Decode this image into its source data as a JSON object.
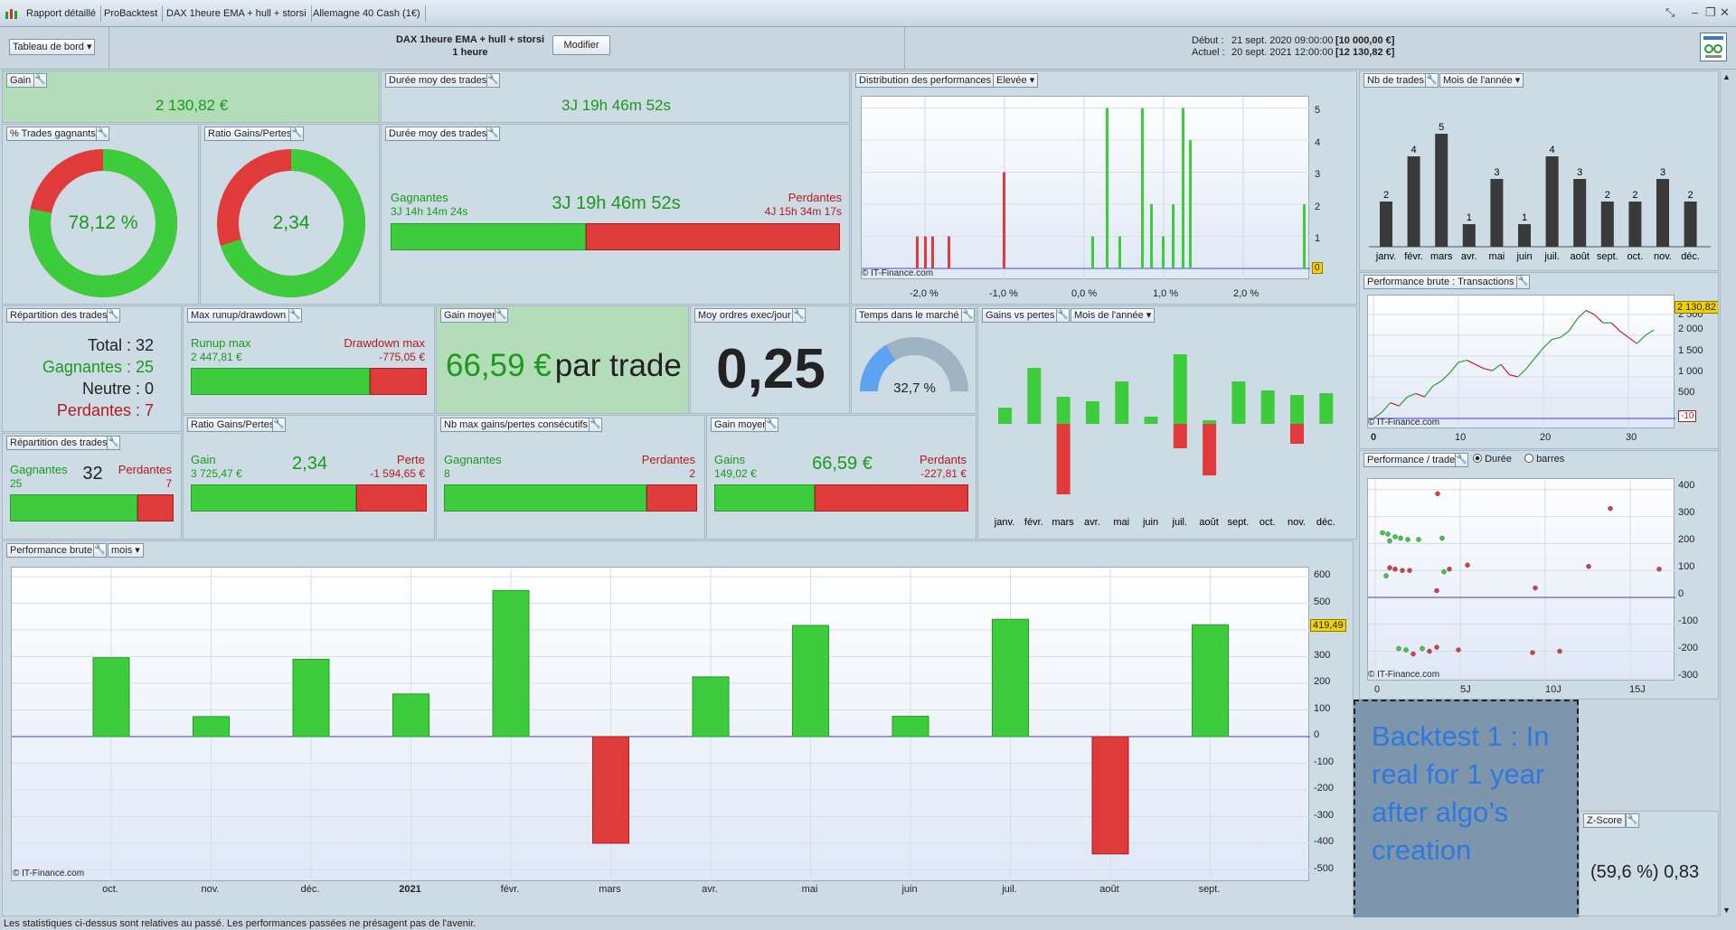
{
  "titlebar": {
    "tabs": [
      "Rapport détaillé",
      "ProBacktest",
      "DAX 1heure EMA + hull + storsi",
      "Allemagne 40 Cash (1€)"
    ]
  },
  "header": {
    "dashboard_select": "Tableau de bord",
    "strategy_name": "DAX 1heure EMA + hull + storsi",
    "timeframe": "1 heure",
    "modify_button": "Modifier",
    "start_label": "Début :",
    "start_date": "21 sept. 2020 09:00:00",
    "start_capital": "[10 000,00 €]",
    "current_label": "Actuel :",
    "current_date": "20 sept. 2021 12:00:00",
    "current_capital": "[12 130,82 €]"
  },
  "gain": {
    "title": "Gain",
    "value": "2 130,82 €"
  },
  "avg_duration": {
    "title": "Durée moy des trades",
    "value": "3J 19h 46m 52s"
  },
  "pct_winners": {
    "title": "% Trades gagnants",
    "value": "78,12 %",
    "fraction": 0.7812
  },
  "ratio_gp": {
    "title": "Ratio Gains/Pertes",
    "value": "2,34",
    "fraction": 0.7004
  },
  "avg_duration2": {
    "title": "Durée moy des trades",
    "win_label": "Gagnantes",
    "win_value": "3J 14h 14m 24s",
    "center": "3J 19h 46m 52s",
    "lose_label": "Perdantes",
    "lose_value": "4J 15h 34m 17s",
    "win_fraction": 0.434
  },
  "distribution": {
    "title": "Distribution des performances",
    "select": "Elevée",
    "credit": "© IT-Finance.com",
    "x_ticks": [
      "-2,0 %",
      "-1,0 %",
      "0,0 %",
      "1,0 %",
      "2,0 %"
    ],
    "y_ticks": [
      "5",
      "4",
      "3",
      "2",
      "1",
      "0"
    ],
    "marker": "0"
  },
  "nb_trades": {
    "title": "Nb de trades",
    "select": "Mois de l'année",
    "categories": [
      "janv.",
      "févr.",
      "mars",
      "avr.",
      "mai",
      "juin",
      "juil.",
      "août",
      "sept.",
      "oct.",
      "nov.",
      "déc."
    ],
    "values": [
      2,
      4,
      5,
      1,
      3,
      1,
      4,
      3,
      2,
      2,
      3,
      2
    ],
    "labels": [
      "2",
      "4",
      "5",
      "1",
      "3",
      "1",
      "4",
      "3",
      "2",
      "2",
      "3",
      "2"
    ]
  },
  "repartition": {
    "title": "Répartition des trades",
    "total": "Total : 32",
    "winners": "Gagnantes : 25",
    "neutral": "Neutre : 0",
    "losers": "Perdantes : 7"
  },
  "runup": {
    "title": "Max runup/drawdown",
    "runup_label": "Runup max",
    "runup_value": "2 447,81 €",
    "drawdown_label": "Drawdown max",
    "drawdown_value": "-775,05 €",
    "win_fraction": 0.76
  },
  "avg_gain": {
    "title": "Gain moyen",
    "value": "66,59 €",
    "suffix": "par trade"
  },
  "orders_day": {
    "title": "Moy ordres exec/jour",
    "value": "0,25"
  },
  "time_market": {
    "title": "Temps dans le marché",
    "value": "32,7 %",
    "fraction": 0.327
  },
  "gains_losses": {
    "title": "Gains vs pertes",
    "select": "Mois de l'année",
    "categories": [
      "janv.",
      "févr.",
      "mars",
      "avr.",
      "mai",
      "juin",
      "juil.",
      "août",
      "sept.",
      "oct.",
      "nov.",
      "déc."
    ],
    "gains": [
      0.18,
      0.62,
      0.3,
      0.25,
      0.47,
      0.08,
      0.77,
      0.04,
      0.47,
      0.37,
      0.32,
      0.34
    ],
    "losses": [
      0,
      0,
      0.78,
      0,
      0,
      0,
      0.27,
      0.57,
      0,
      0,
      0.22,
      0
    ]
  },
  "repartition2": {
    "title": "Répartition des trades",
    "win_label": "Gagnantes",
    "win_value": "25",
    "center": "32",
    "lose_label": "Perdantes",
    "lose_value": "7",
    "win_fraction": 0.78
  },
  "ratio_gp2": {
    "title": "Ratio Gains/Pertes",
    "gain_label": "Gain",
    "gain_value": "3 725,47 €",
    "center": "2,34",
    "loss_label": "Perte",
    "loss_value": "-1 594,65 €",
    "win_fraction": 0.7
  },
  "consecutive": {
    "title": "Nb max gains/pertes consécutifs",
    "win_label": "Gagnantes",
    "win_value": "8",
    "lose_label": "Perdantes",
    "lose_value": "2",
    "win_fraction": 0.8
  },
  "avg_gain2": {
    "title": "Gain moyen",
    "win_label": "Gains",
    "win_value": "149,02 €",
    "center": "66,59 €",
    "lose_label": "Perdants",
    "lose_value": "-227,81 €",
    "win_fraction": 0.395
  },
  "perf_brute_tx": {
    "title": "Performance brute : Transactions",
    "credit": "© IT-Finance.com",
    "x_ticks": [
      "0",
      "10",
      "20",
      "30"
    ],
    "y_ticks": [
      "2 500",
      "2 000",
      "1 500",
      "1 000",
      "500",
      "0"
    ],
    "last_value": "2 130,82",
    "min_value": "-10",
    "equity": [
      0,
      150,
      380,
      300,
      520,
      600,
      520,
      780,
      900,
      1100,
      1350,
      1400,
      1300,
      1200,
      1150,
      1300,
      1050,
      1000,
      1200,
      1450,
      1700,
      1900,
      1950,
      2100,
      2400,
      2600,
      2500,
      2300,
      2300,
      2100,
      1950,
      1800,
      2000,
      2130.82
    ]
  },
  "perf_trade": {
    "title": "Performance / trade",
    "radio_duration": "Durée",
    "radio_bars": "barres",
    "credit": "© IT-Finance.com",
    "x_ticks": [
      "0",
      "5J",
      "10J",
      "15J"
    ],
    "y_ticks": [
      "400",
      "300",
      "200",
      "100",
      "0",
      "-100",
      "-200",
      "-300"
    ]
  },
  "perf_brute": {
    "title": "Performance brute",
    "select": "mois",
    "credit": "© IT-Finance.com",
    "categories": [
      "oct.",
      "nov.",
      "déc.",
      "2021",
      "févr.",
      "mars",
      "avr.",
      "mai",
      "juin",
      "juil.",
      "août",
      "sept."
    ],
    "values": [
      296,
      75,
      290,
      160,
      548,
      -400,
      224,
      417,
      76,
      440,
      -440,
      419.49
    ],
    "y_ticks": [
      "600",
      "500",
      "400",
      "300",
      "200",
      "100",
      "0",
      "-100",
      "-200",
      "-300",
      "-400",
      "-500"
    ],
    "marker": "419,49"
  },
  "zscore": {
    "title": "Z-Score",
    "value": "(59,6 %) 0,83"
  },
  "annotation": "Backtest 1 : In real for 1 year after algo’s creation",
  "footer": "Les statistiques ci-dessus sont relatives au passé. Les performances passées ne présagent pas de l'avenir."
}
